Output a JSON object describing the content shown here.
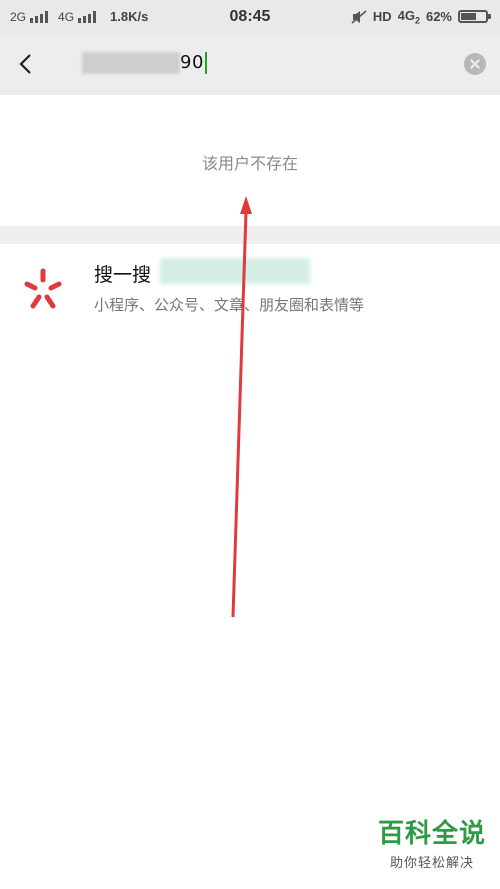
{
  "status_bar": {
    "net1": "2G",
    "net2": "4G",
    "speed": "1.8K/s",
    "time": "08:45",
    "hd": "HD",
    "net3": "4G",
    "net3_sub": "2",
    "battery": "62%",
    "battery_level": 0.62
  },
  "search": {
    "query_visible_suffix": "90"
  },
  "message": {
    "not_found": "该用户不存在"
  },
  "result": {
    "title_prefix": "搜一搜",
    "subtitle": "小程序、公众号、文章、朋友圈和表情等"
  },
  "watermark": {
    "main": "百科全说",
    "sub": "助你轻松解决"
  },
  "colors": {
    "accent_red": "#e0393e",
    "watermark_green": "#2f9a45"
  }
}
